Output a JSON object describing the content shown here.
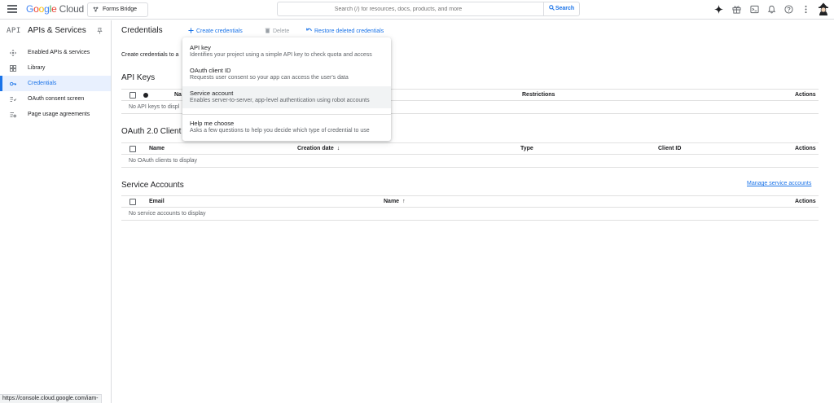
{
  "topbar": {
    "logo_parts": [
      "G",
      "o",
      "o",
      "g",
      "l",
      "e",
      " Cloud"
    ],
    "project": "Forms Bridge",
    "search_placeholder": "Search (/) for resources, docs, products, and more",
    "search_button": "Search",
    "icons": [
      "gemini-sparkle-icon",
      "gift-icon",
      "cloud-shell-icon",
      "notifications-icon",
      "help-icon",
      "more-vert-icon",
      "avatar"
    ]
  },
  "sidebar": {
    "api_label": "API",
    "title": "APIs & Services",
    "items": [
      {
        "label": "Enabled APIs & services",
        "icon": "move-icon"
      },
      {
        "label": "Library",
        "icon": "library-grid-icon"
      },
      {
        "label": "Credentials",
        "icon": "key-icon",
        "active": true
      },
      {
        "label": "OAuth consent screen",
        "icon": "consent-list-icon"
      },
      {
        "label": "Page usage agreements",
        "icon": "settings-list-icon"
      }
    ]
  },
  "main": {
    "title": "Credentials",
    "actions": {
      "create": "Create credentials",
      "delete": "Delete",
      "restore": "Restore deleted credentials"
    },
    "intro": "Create credentials to a",
    "api_keys": {
      "title": "API Keys",
      "columns": {
        "name": "Na",
        "restrictions": "Restrictions",
        "actions": "Actions"
      },
      "empty": "No API keys to displ"
    },
    "oauth": {
      "title": "OAuth 2.0 Client I",
      "columns": {
        "name": "Name",
        "creation_date": "Creation date",
        "type": "Type",
        "client_id": "Client ID",
        "actions": "Actions"
      },
      "empty": "No OAuth clients to display"
    },
    "service_accounts": {
      "title": "Service Accounts",
      "manage_link": "Manage service accounts",
      "columns": {
        "email": "Email",
        "name": "Name",
        "actions": "Actions"
      },
      "empty": "No service accounts to display"
    }
  },
  "menu": {
    "items": [
      {
        "title": "API key",
        "desc": "Identifies your project using a simple API key to check quota and access"
      },
      {
        "title": "OAuth client ID",
        "desc": "Requests user consent so your app can access the user's data"
      },
      {
        "title": "Service account",
        "desc": "Enables server-to-server, app-level authentication using robot accounts",
        "highlighted": true
      },
      {
        "title": "Help me choose",
        "desc": "Asks a few questions to help you decide which type of credential to use"
      }
    ]
  },
  "statusbar": {
    "url": "https://console.cloud.google.com/iam-"
  },
  "colors": {
    "accent": "#1a73e8",
    "active_bg": "#e8f0fe",
    "border": "#dadce0",
    "muted": "#5f6368"
  }
}
